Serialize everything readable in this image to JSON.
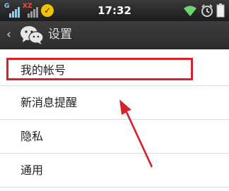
{
  "status_bar": {
    "sim1_tag": "G",
    "sim2_tag": "XZ",
    "time": "17:32",
    "icons": [
      "signal-icon",
      "signal-icon",
      "app-notification-icon",
      "wifi-icon",
      "alarm-icon",
      "battery-icon"
    ]
  },
  "header": {
    "back_icon": "chevron-left-icon",
    "app_icon": "wechat-icon",
    "title": "设置"
  },
  "settings": {
    "items": [
      {
        "label": "我的帐号"
      },
      {
        "label": "新消息提醒"
      },
      {
        "label": "隐私"
      },
      {
        "label": "通用"
      }
    ]
  },
  "annotation": {
    "highlight_color": "#d4232c",
    "highlighted_item": "我的帐号"
  }
}
